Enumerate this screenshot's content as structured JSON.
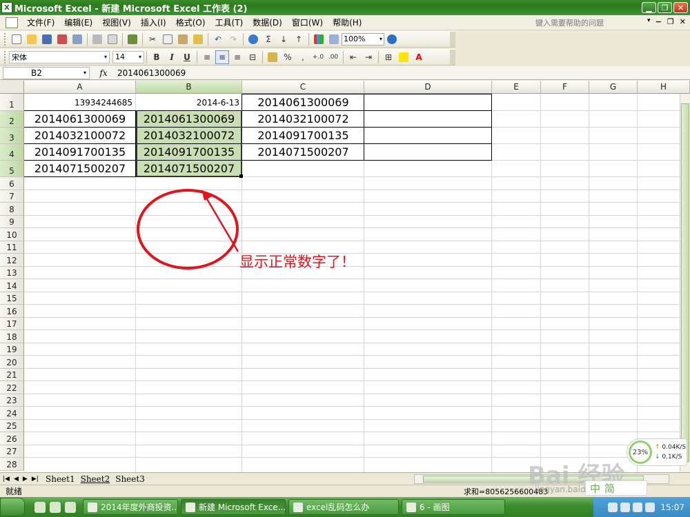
{
  "window": {
    "title": "Microsoft Excel - 新建 Microsoft Excel 工作表 (2)",
    "app_icon_label": "X",
    "minimize": "▁",
    "restore": "❐",
    "close": "✕"
  },
  "menu": {
    "items": [
      "文件(F)",
      "编辑(E)",
      "视图(V)",
      "插入(I)",
      "格式(O)",
      "工具(T)",
      "数据(D)",
      "窗口(W)",
      "帮助(H)"
    ],
    "help_placeholder": "键入需要帮助的问题",
    "help_dropdown": "▾"
  },
  "toolbar": {
    "zoom": "100%",
    "font_name": "宋体",
    "font_size": "14",
    "bold": "B",
    "italic": "I",
    "underline": "U",
    "sigma": "Σ",
    "percent": "%",
    "comma": ","
  },
  "formula_bar": {
    "name_box": "B2",
    "fx": "fx",
    "value": "2014061300069"
  },
  "columns": [
    "A",
    "B",
    "C",
    "D",
    "E",
    "F",
    "G",
    "H"
  ],
  "rows": [
    "1",
    "2",
    "3",
    "4",
    "5",
    "6",
    "7",
    "8",
    "9",
    "10",
    "11",
    "12",
    "13",
    "14",
    "15",
    "16",
    "17",
    "18",
    "19",
    "20",
    "21",
    "22",
    "23",
    "24",
    "25",
    "26",
    "27",
    "28"
  ],
  "cells": {
    "A1": "13934244685",
    "B1": "2014-6-13",
    "C1": "2014061300069",
    "A2": "2014061300069",
    "B2": "2014061300069",
    "C2": "2014032100072",
    "A3": "2014032100072",
    "B3": "2014032100072",
    "C3": "2014091700135",
    "A4": "2014091700135",
    "B4": "2014091700135",
    "C4": "2014071500207",
    "A5": "2014071500207",
    "B5": "2014071500207"
  },
  "annotation": {
    "text": "显示正常数字了！",
    "color": "#e1141b"
  },
  "sheets": {
    "tabs": [
      "Sheet1",
      "Sheet2",
      "Sheet3"
    ],
    "active": "Sheet2"
  },
  "status": {
    "ready": "就绪",
    "sum": "求和=8056256600483"
  },
  "taskbar": {
    "tasks": [
      "2014年度外商投资...",
      "新建 Microsoft Exce...",
      "excel乱码怎么办",
      "6 - 画图"
    ],
    "active_task": "新建 Microsoft Exce...",
    "clock": "15:07"
  },
  "net_widget": {
    "percent": "23%",
    "upload": "0.04K/S",
    "download": "0.1K/S"
  },
  "ime": {
    "label": "中",
    "mode": "简"
  },
  "watermark": {
    "brand": "Bai 经验",
    "url": "jingyan.baidu.com"
  }
}
